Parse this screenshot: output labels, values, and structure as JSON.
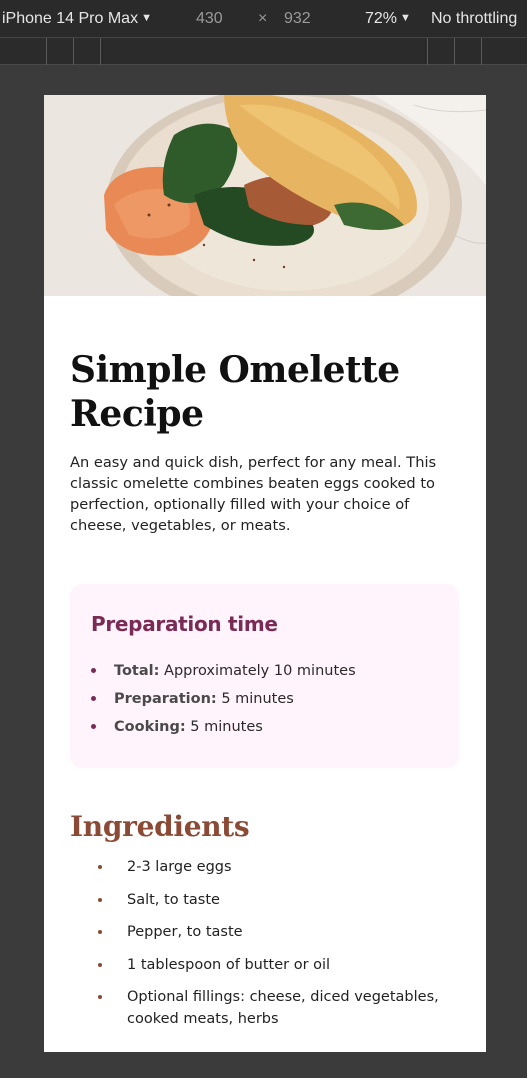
{
  "devtools": {
    "device": "iPhone 14 Pro Max",
    "width": "430",
    "times": "×",
    "height": "932",
    "zoom": "72%",
    "throttle": "No throttling"
  },
  "recipe": {
    "title": "Simple Omelette Recipe",
    "intro": "An easy and quick dish, perfect for any meal. This classic omelette combines beaten eggs cooked to perfection, optionally filled with your choice of cheese, vegetables, or meats.",
    "preparation": {
      "heading": "Preparation time",
      "items": [
        {
          "key": "Total:",
          "value": "Approximately 10 minutes"
        },
        {
          "key": "Preparation:",
          "value": "5 minutes"
        },
        {
          "key": "Cooking:",
          "value": "5 minutes"
        }
      ]
    },
    "ingredients": {
      "heading": "Ingredients",
      "items": [
        "2-3 large eggs",
        "Salt, to taste",
        "Pepper, to taste",
        "1 tablespoon of butter or oil",
        "Optional fillings: cheese, diced vegetables, cooked meats, herbs"
      ]
    }
  },
  "colors": {
    "accent_prep": "#7a2b55",
    "accent_ingredients": "#8b4a36",
    "prep_background": "#fff4fb"
  }
}
